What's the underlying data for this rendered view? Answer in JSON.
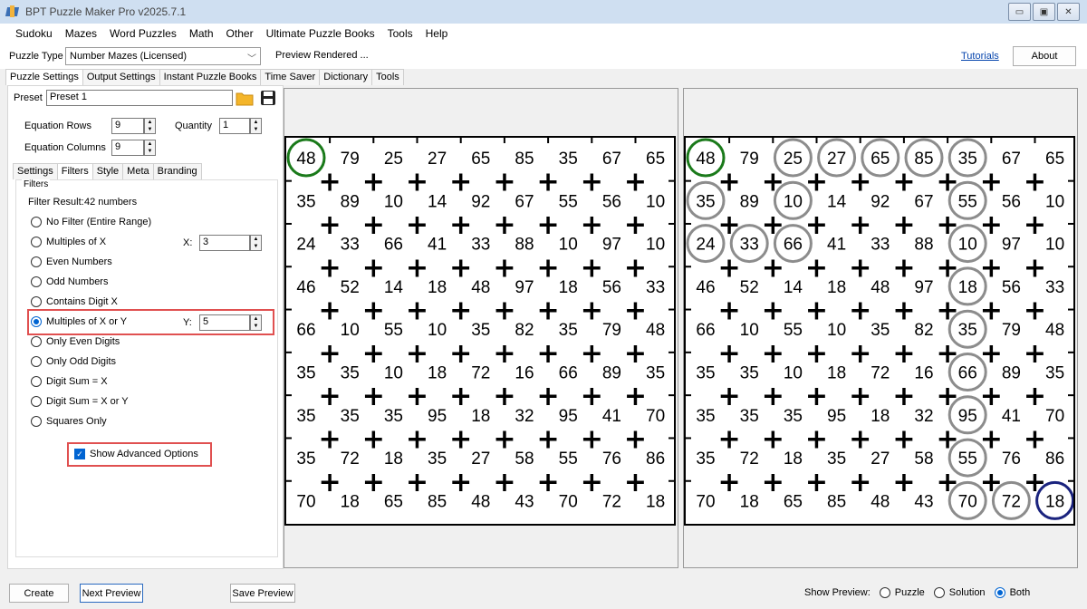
{
  "window": {
    "title": "BPT Puzzle Maker Pro v2025.7.1"
  },
  "menu": [
    "Sudoku",
    "Mazes",
    "Word Puzzles",
    "Math",
    "Other",
    "Ultimate Puzzle Books",
    "Tools",
    "Help"
  ],
  "puzzle_type": {
    "label": "Puzzle Type",
    "value": "Number Mazes (Licensed)",
    "status": "Preview Rendered ..."
  },
  "links": {
    "tutorials": "Tutorials",
    "about": "About"
  },
  "main_tabs": [
    "Puzzle Settings",
    "Output Settings",
    "Instant Puzzle Books",
    "Time Saver",
    "Dictionary",
    "Tools"
  ],
  "preset": {
    "label": "Preset",
    "value": "Preset 1"
  },
  "equation": {
    "rows_label": "Equation Rows",
    "rows": "9",
    "columns_label": "Equation Columns",
    "columns": "9",
    "quantity_label": "Quantity",
    "quantity": "1"
  },
  "sub_tabs": [
    "Settings",
    "Filters",
    "Style",
    "Meta",
    "Branding"
  ],
  "filters": {
    "group_label": "Filters",
    "result_label": "Filter Result:",
    "result_value": "42 numbers",
    "x_label": "X:",
    "x_value": "3",
    "y_label": "Y:",
    "y_value": "5",
    "options": [
      "No Filter (Entire Range)",
      "Multiples of X",
      "Even Numbers",
      "Odd Numbers",
      "Contains Digit X",
      "Multiples of X or Y",
      "Only Even Digits",
      "Only Odd Digits",
      "Digit Sum = X",
      "Digit Sum = X or Y",
      "Squares Only"
    ],
    "selected_index": 5,
    "advanced_label": "Show Advanced Options"
  },
  "grid": {
    "cells": [
      [
        48,
        79,
        25,
        27,
        65,
        85,
        35,
        67,
        65
      ],
      [
        35,
        89,
        10,
        14,
        92,
        67,
        55,
        56,
        10
      ],
      [
        24,
        33,
        66,
        41,
        33,
        88,
        10,
        97,
        10
      ],
      [
        46,
        52,
        14,
        18,
        48,
        97,
        18,
        56,
        33
      ],
      [
        66,
        10,
        55,
        10,
        35,
        82,
        35,
        79,
        48
      ],
      [
        35,
        35,
        10,
        18,
        72,
        16,
        66,
        89,
        35
      ],
      [
        35,
        35,
        35,
        95,
        18,
        32,
        95,
        41,
        70
      ],
      [
        35,
        72,
        18,
        35,
        27,
        58,
        55,
        76,
        86
      ],
      [
        70,
        18,
        65,
        85,
        48,
        43,
        70,
        72,
        18
      ]
    ],
    "operator": "+",
    "start": [
      0,
      0
    ],
    "end": [
      8,
      8
    ],
    "solution_path": [
      [
        0,
        0
      ],
      [
        1,
        0
      ],
      [
        2,
        0
      ],
      [
        2,
        1
      ],
      [
        2,
        2
      ],
      [
        1,
        2
      ],
      [
        0,
        2
      ],
      [
        0,
        3
      ],
      [
        0,
        4
      ],
      [
        0,
        5
      ],
      [
        0,
        6
      ],
      [
        1,
        6
      ],
      [
        2,
        6
      ],
      [
        3,
        6
      ],
      [
        4,
        6
      ],
      [
        5,
        6
      ],
      [
        6,
        6
      ],
      [
        7,
        6
      ],
      [
        8,
        6
      ],
      [
        8,
        7
      ],
      [
        8,
        8
      ]
    ],
    "colors": {
      "start": "#1a7a1a",
      "end": "#1a237e",
      "path": "#8c8c8c"
    }
  },
  "bottom": {
    "create": "Create",
    "next_preview": "Next Preview",
    "save_preview": "Save Preview",
    "show_preview_label": "Show Preview:",
    "show_preview_options": [
      "Puzzle",
      "Solution",
      "Both"
    ],
    "show_preview_selected": 2
  }
}
